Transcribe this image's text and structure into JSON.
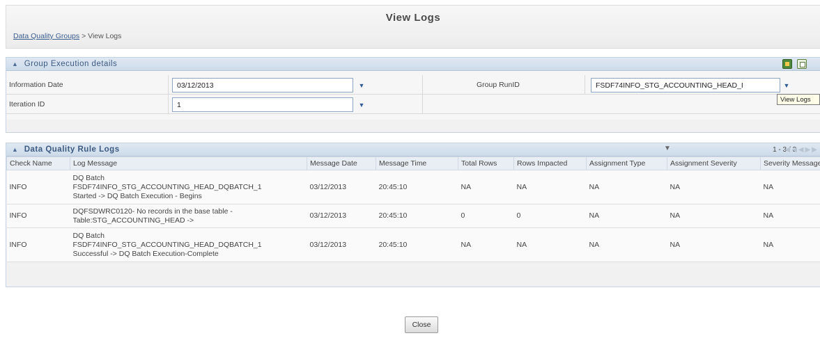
{
  "header": {
    "title": "View Logs",
    "breadcrumb_link": "Data Quality Groups",
    "breadcrumb_separator": ">",
    "breadcrumb_current": "View Logs"
  },
  "execution_panel": {
    "title": "Group Execution details",
    "information_date_label": "Information Date",
    "information_date_value": "03/12/2013",
    "group_runid_label": "Group RunID",
    "group_runid_value": "FSDF74INFO_STG_ACCOUNTING_HEAD_I",
    "iteration_id_label": "Iteration ID",
    "iteration_id_value": "1",
    "tooltip": "View Logs"
  },
  "logs_panel": {
    "title": "Data Quality Rule Logs",
    "pager_text": "1 - 3 / 3",
    "columns": [
      "Check Name",
      "Log Message",
      "Message Date",
      "Message Time",
      "Total Rows",
      "Rows Impacted",
      "Assignment Type",
      "Assignment Severity",
      "Severity Message"
    ],
    "rows": [
      {
        "check_name": "INFO",
        "message_lines": [
          "DQ Batch",
          "FSDF74INFO_STG_ACCOUNTING_HEAD_DQBATCH_1",
          "Started -> DQ Batch Execution - Begins"
        ],
        "message_date": "03/12/2013",
        "message_time": "20:45:10",
        "total_rows": "NA",
        "rows_impacted": "NA",
        "assignment_type": "NA",
        "assignment_severity": "NA",
        "severity_message": "NA"
      },
      {
        "check_name": "INFO",
        "message_lines": [
          "DQFSDWRC0120- No records in the base table -",
          "Table:STG_ACCOUNTING_HEAD ->"
        ],
        "message_date": "03/12/2013",
        "message_time": "20:45:10",
        "total_rows": "0",
        "rows_impacted": "0",
        "assignment_type": "NA",
        "assignment_severity": "NA",
        "severity_message": "NA"
      },
      {
        "check_name": "INFO",
        "message_lines": [
          "DQ Batch",
          "FSDF74INFO_STG_ACCOUNTING_HEAD_DQBATCH_1",
          "Successful -> DQ Batch Execution-Complete"
        ],
        "message_date": "03/12/2013",
        "message_time": "20:45:10",
        "total_rows": "NA",
        "rows_impacted": "NA",
        "assignment_type": "NA",
        "assignment_severity": "NA",
        "severity_message": "NA"
      }
    ]
  },
  "footer": {
    "close_label": "Close"
  },
  "icons": {
    "collapse": "chevron-up-icon",
    "dropdown": "chevron-down-icon",
    "filter": "filter-icon",
    "export": "export-excel-icon",
    "copy": "copy-icon"
  },
  "colors": {
    "panel_header": "#d6e1ee",
    "panel_title": "#3d5a80",
    "link": "#3a5d8f"
  }
}
